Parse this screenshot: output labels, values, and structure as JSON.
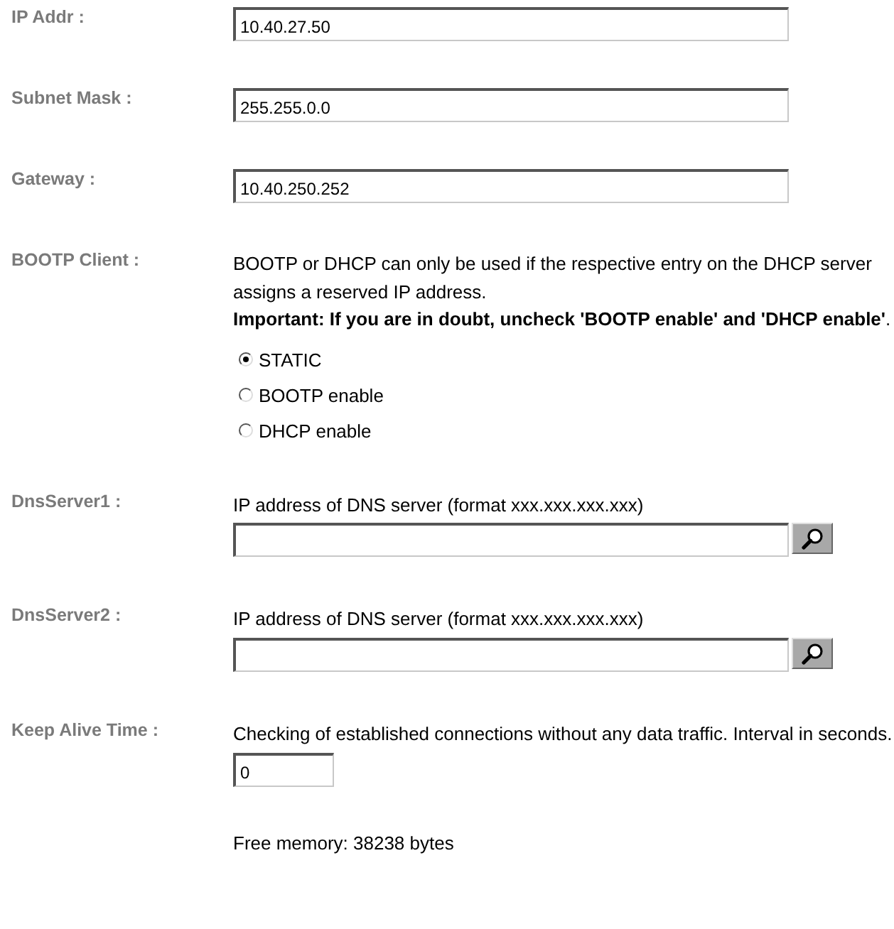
{
  "rows": [
    {
      "label": "IP Addr :",
      "kind": "text",
      "value": "10.40.27.50"
    },
    {
      "label": "Subnet Mask :",
      "kind": "text",
      "value": "255.255.0.0"
    },
    {
      "label": "Gateway :",
      "kind": "text",
      "value": "10.40.250.252"
    },
    {
      "label": "BOOTP Client :",
      "kind": "radio",
      "description": "BOOTP or DHCP can only be used if the respective entry on the DHCP server assigns a reserved IP address.",
      "warning": "**Important: If you are in doubt, uncheck 'BOOTP enable' and 'DHCP enable'**.",
      "options": [
        {
          "label": "STATIC",
          "selected": true
        },
        {
          "label": "BOOTP enable",
          "selected": false
        },
        {
          "label": "DHCP enable",
          "selected": false
        }
      ]
    },
    {
      "label": "DnsServer1 :",
      "kind": "search",
      "description": "IP address of DNS server (format xxx.xxx.xxx.xxx)"
    },
    {
      "label": "DnsServer2 :",
      "kind": "search",
      "description": "IP address of DNS server (format xxx.xxx.xxx.xxx)"
    },
    {
      "label": "Keep Alive Time :",
      "kind": "number",
      "description": "Checking of established connections without any data traffic. Interval in seconds.",
      "value": "0"
    }
  ],
  "footer": "Free memory: 38238 bytes"
}
